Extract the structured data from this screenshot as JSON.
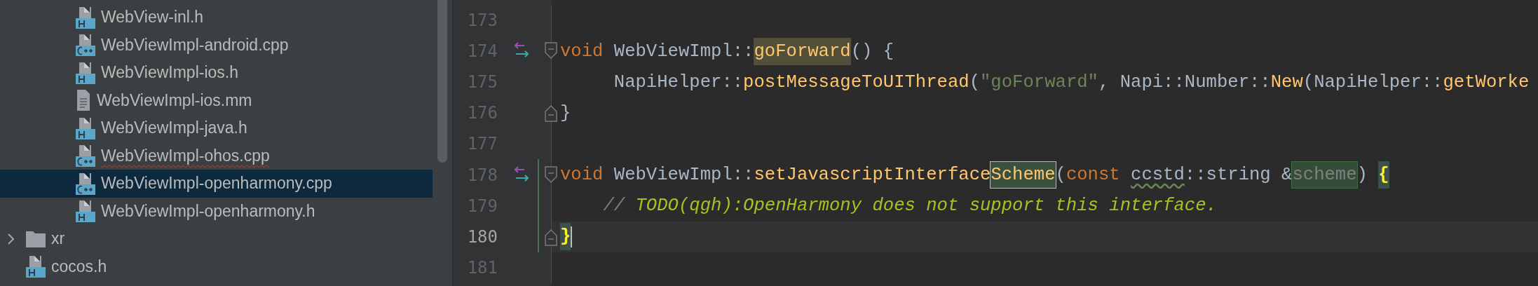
{
  "project_tree": [
    {
      "children": [
        {
          "name": "WebView-inl.h",
          "kind": "header",
          "selected": false,
          "has_error": false
        },
        {
          "name": "WebViewImpl-android.cpp",
          "kind": "cpp",
          "selected": false,
          "has_error": false
        },
        {
          "name": "WebViewImpl-ios.h",
          "kind": "header",
          "selected": false,
          "has_error": false
        },
        {
          "name": "WebViewImpl-ios.mm",
          "kind": "text",
          "selected": false,
          "has_error": false
        },
        {
          "name": "WebViewImpl-java.h",
          "kind": "header",
          "selected": false,
          "has_error": false
        },
        {
          "name": "WebViewImpl-ohos.cpp",
          "kind": "cpp",
          "selected": false,
          "has_error": true
        },
        {
          "name": "WebViewImpl-openharmony.cpp",
          "kind": "cpp",
          "selected": true,
          "has_error": false
        },
        {
          "name": "WebViewImpl-openharmony.h",
          "kind": "header",
          "selected": false,
          "has_error": false
        }
      ]
    },
    {
      "name": "xr",
      "kind": "folder",
      "expanded": false,
      "selected": false,
      "has_error": false
    },
    {
      "name": "cocos.h",
      "kind": "header",
      "selected": false,
      "has_error": false
    }
  ],
  "editor": {
    "lines": [
      {
        "number": "173",
        "current": false,
        "impl_marker": false,
        "fold_start": false,
        "fold_end": false,
        "changed": false
      },
      {
        "number": "174",
        "current": false,
        "impl_marker": true,
        "fold_start": true,
        "fold_end": false,
        "changed": false,
        "tokens": [
          {
            "text": "void",
            "kind": "keyword"
          },
          {
            "text": " WebViewImpl::",
            "kind": "plain"
          },
          {
            "text": "goForward",
            "kind": "func-usage"
          },
          {
            "text": "() {",
            "kind": "plain"
          }
        ]
      },
      {
        "number": "175",
        "current": false,
        "impl_marker": false,
        "fold_start": false,
        "fold_end": false,
        "changed": false,
        "tokens": [
          {
            "text": "     NapiHelper::",
            "kind": "plain"
          },
          {
            "text": "postMessageToUIThread",
            "kind": "func"
          },
          {
            "text": "(",
            "kind": "plain"
          },
          {
            "text": "\"goForward\"",
            "kind": "string"
          },
          {
            "text": ", Napi::Number::",
            "kind": "plain"
          },
          {
            "text": "New",
            "kind": "func"
          },
          {
            "text": "(NapiHelper::",
            "kind": "plain"
          },
          {
            "text": "getWorke",
            "kind": "func"
          }
        ]
      },
      {
        "number": "176",
        "current": false,
        "impl_marker": false,
        "fold_start": false,
        "fold_end": true,
        "changed": false,
        "tokens": [
          {
            "text": "}",
            "kind": "plain"
          }
        ]
      },
      {
        "number": "177",
        "current": false,
        "impl_marker": false,
        "fold_start": false,
        "fold_end": false,
        "changed": false
      },
      {
        "number": "178",
        "current": false,
        "impl_marker": true,
        "fold_start": true,
        "fold_end": false,
        "changed": true,
        "tokens": [
          {
            "text": "void",
            "kind": "keyword"
          },
          {
            "text": " WebViewImpl::",
            "kind": "plain"
          },
          {
            "text": "setJavascriptInterface",
            "kind": "func"
          },
          {
            "text": "Scheme",
            "kind": "func-boxed"
          },
          {
            "text": "(",
            "kind": "plain"
          },
          {
            "text": "const ",
            "kind": "keyword"
          },
          {
            "text": "ccstd",
            "kind": "typo"
          },
          {
            "text": "::string &",
            "kind": "plain"
          },
          {
            "text": "scheme",
            "kind": "param-unused"
          },
          {
            "text": ") ",
            "kind": "plain"
          },
          {
            "text": "{",
            "kind": "brace-match"
          }
        ]
      },
      {
        "number": "179",
        "current": false,
        "impl_marker": false,
        "fold_start": false,
        "fold_end": false,
        "changed": true,
        "tokens": [
          {
            "text": "    // ",
            "kind": "comment"
          },
          {
            "text": "TODO(qgh):OpenHarmony does not support this interface.",
            "kind": "todo"
          }
        ]
      },
      {
        "number": "180",
        "current": true,
        "impl_marker": false,
        "fold_start": false,
        "fold_end": true,
        "changed": true,
        "tokens": [
          {
            "text": "}",
            "kind": "brace-match"
          }
        ]
      },
      {
        "number": "181",
        "current": false,
        "impl_marker": false,
        "fold_start": false,
        "fold_end": false,
        "changed": false
      }
    ]
  }
}
